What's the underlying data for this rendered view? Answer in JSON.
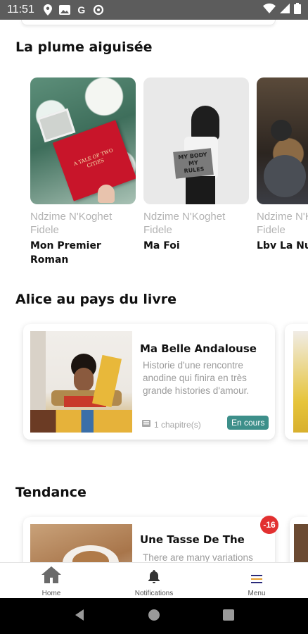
{
  "status_bar": {
    "time": "11:51",
    "left_icons": [
      "location-icon",
      "image-icon",
      "google-icon",
      "data-saver-icon"
    ],
    "right_icons": [
      "wifi-icon",
      "signal-icon",
      "battery-icon"
    ]
  },
  "sections": [
    {
      "title": "La plume aiguisée",
      "books": [
        {
          "author": "Ndzime N'Koghet Fidele",
          "title": "Mon Premier Roman"
        },
        {
          "author": "Ndzime N'Koghet Fidele",
          "title": "Ma Foi"
        },
        {
          "author": "Ndzime N'Koghet Fidele",
          "title": "Lbv La Nuit"
        }
      ]
    },
    {
      "title": "Alice au pays du livre",
      "card": {
        "title": "Ma Belle Andalouse",
        "description": "Historie d'une rencontre anodine qui finira en très grande histories d'amour.",
        "chapters": "1 chapitre(s)",
        "status": "En cours"
      }
    },
    {
      "title": "Tendance",
      "card": {
        "title": "Une Tasse De The",
        "description": "There are many variations",
        "discount": "-16"
      }
    }
  ],
  "bottom_nav": {
    "items": [
      {
        "label": "Home",
        "icon": "home-icon"
      },
      {
        "label": "Notifications",
        "icon": "bell-icon"
      },
      {
        "label": "Menu",
        "icon": "menu-icon"
      }
    ]
  },
  "cover_art": {
    "book1_text": "A TALE OF TWO CITIES",
    "book2_text": "MY BODY MY RULES"
  },
  "colors": {
    "status_bar": "#5c5c5c",
    "badge": "#3d8f8a",
    "discount": "#e23030",
    "author_gray": "#b3b3b3"
  }
}
